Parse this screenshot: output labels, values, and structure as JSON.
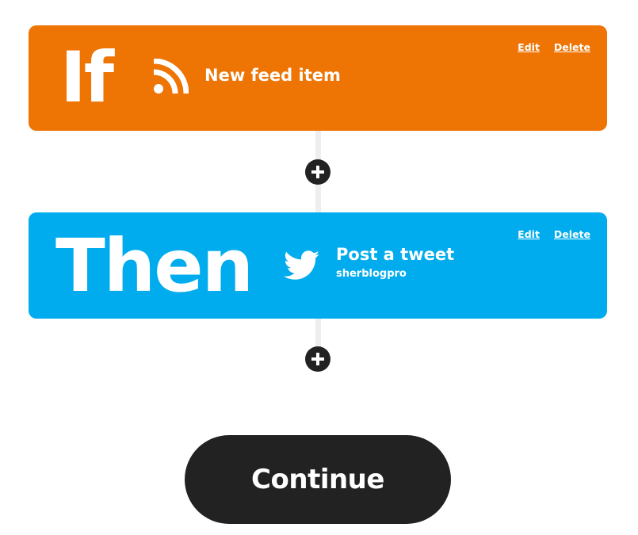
{
  "trigger": {
    "keyword": "If",
    "service_icon": "rss-icon",
    "title": "New feed item",
    "edit_label": "Edit",
    "delete_label": "Delete",
    "color": "#EE7404"
  },
  "action": {
    "keyword": "Then",
    "service_icon": "twitter-icon",
    "title": "Post a tweet",
    "account": "sherblogpro",
    "edit_label": "Edit",
    "delete_label": "Delete",
    "color": "#00ACED"
  },
  "add_buttons": [
    {
      "icon": "plus-icon"
    },
    {
      "icon": "plus-icon"
    }
  ],
  "continue_label": "Continue",
  "colors": {
    "dark": "#222222",
    "connector": "#EEEEEE"
  }
}
